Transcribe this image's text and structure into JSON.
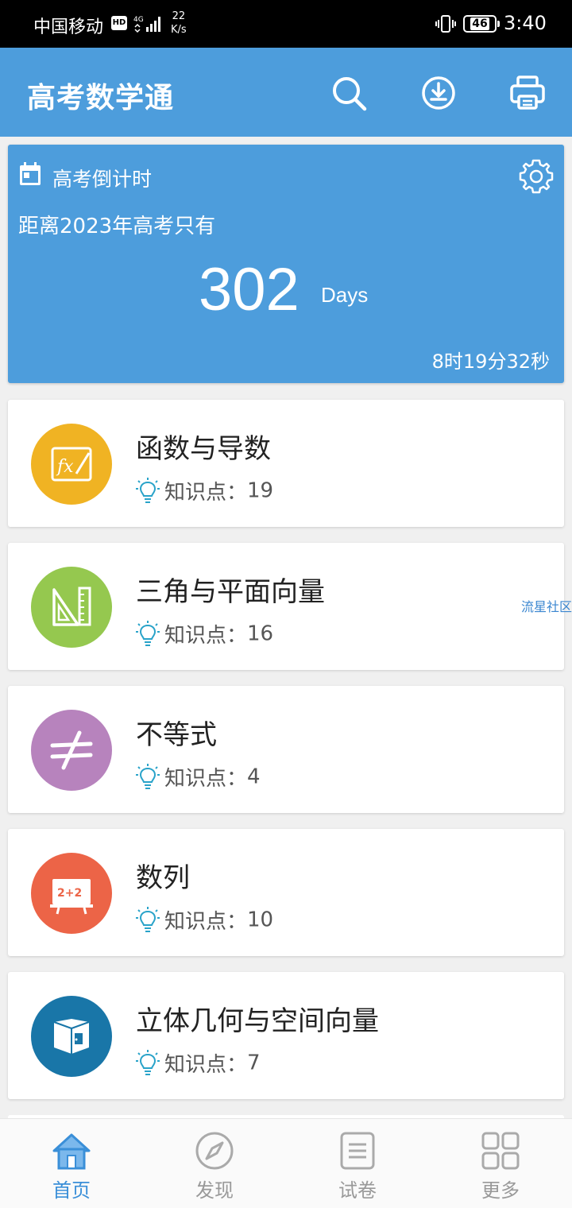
{
  "status_bar": {
    "carrier": "中国移动",
    "hd_badge": "HD",
    "network": "4G",
    "speed_value": "22",
    "speed_unit": "K/s",
    "battery": "46",
    "time": "3:40"
  },
  "app_bar": {
    "title": "高考数学通",
    "icons": [
      "search-icon",
      "download-icon",
      "print-icon"
    ]
  },
  "countdown": {
    "title": "高考倒计时",
    "subtitle": "距离2023年高考只有",
    "days": "302",
    "days_unit": "Days",
    "remaining_time": "8时19分32秒",
    "accent_color": "#4d9ddc"
  },
  "topics": [
    {
      "name": "函数与导数",
      "label": "知识点：",
      "count": "19",
      "icon": "function-icon",
      "color": "#f0b323"
    },
    {
      "name": "三角与平面向量",
      "label": "知识点：",
      "count": "16",
      "icon": "ruler-triangle-icon",
      "color": "#95c84f"
    },
    {
      "name": "不等式",
      "label": "知识点：",
      "count": "4",
      "icon": "not-equal-icon",
      "color": "#b783bd"
    },
    {
      "name": "数列",
      "label": "知识点：",
      "count": "10",
      "icon": "blackboard-icon",
      "color": "#ec6447"
    },
    {
      "name": "立体几何与空间向量",
      "label": "知识点：",
      "count": "7",
      "icon": "cube-icon",
      "color": "#1976a8"
    }
  ],
  "watermark": "流星社区",
  "bottom_nav": [
    {
      "label": "首页",
      "icon": "home-icon",
      "active": true
    },
    {
      "label": "发现",
      "icon": "compass-icon",
      "active": false
    },
    {
      "label": "试卷",
      "icon": "document-icon",
      "active": false
    },
    {
      "label": "更多",
      "icon": "grid-icon",
      "active": false
    }
  ]
}
